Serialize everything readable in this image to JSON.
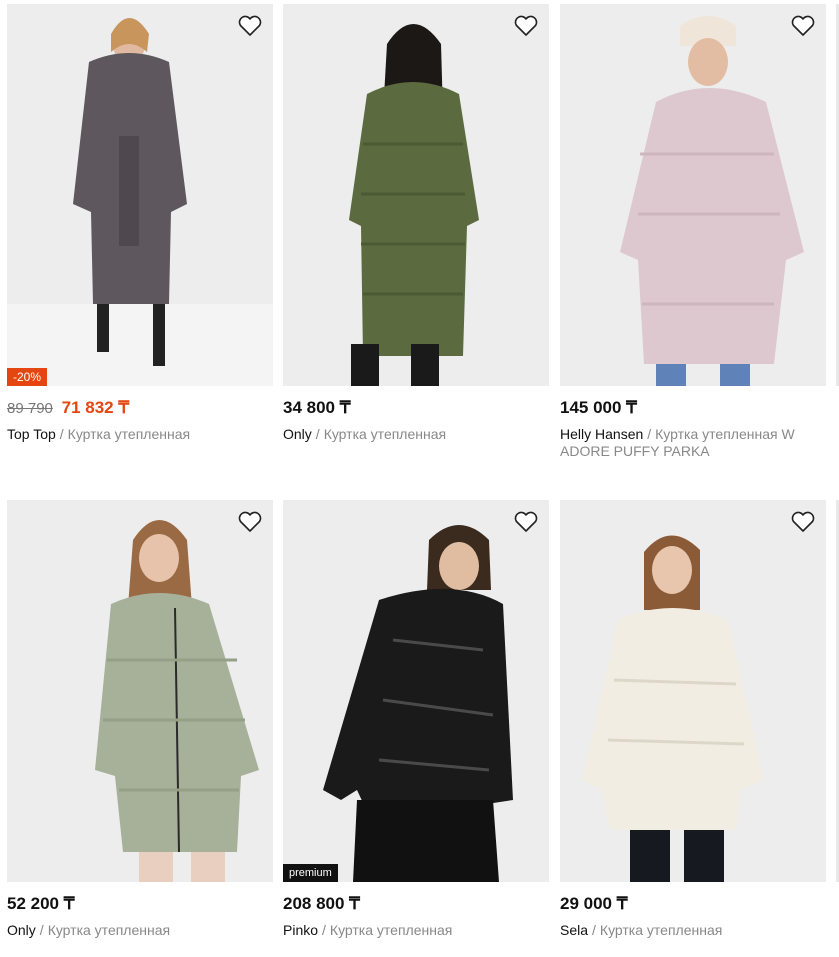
{
  "currency": "₸",
  "products": [
    {
      "price": "71 832 ₸",
      "old_price": "89 790",
      "discount": "-20%",
      "brand": "Top Top",
      "name": "Куртка утепленная",
      "coat_color": "#5e585e"
    },
    {
      "price": "34 800 ₸",
      "brand": "Only",
      "name": "Куртка утепленная",
      "coat_color": "#5b6b3f"
    },
    {
      "price": "145 000 ₸",
      "brand": "Helly Hansen",
      "name": "Куртка утепленная W ADORE PUFFY PARKA",
      "coat_color": "#ddc8cf"
    },
    {
      "price": "52 200 ₸",
      "brand": "Only",
      "name": "Куртка утепленная",
      "coat_color": "#a7b19a"
    },
    {
      "price": "208 800 ₸",
      "brand": "Pinko",
      "name": "Куртка утепленная",
      "premium": "premium",
      "coat_color": "#1a1a1a"
    },
    {
      "price": "29 000 ₸",
      "brand": "Sela",
      "name": "Куртка утепленная",
      "coat_color": "#f1ede3"
    }
  ],
  "separator": "/",
  "icons": {
    "favorite": "heart-outline-icon"
  },
  "colors": {
    "accent": "#e4460f",
    "text": "#111111",
    "muted": "#888888",
    "photo_bg": "#ededed"
  }
}
